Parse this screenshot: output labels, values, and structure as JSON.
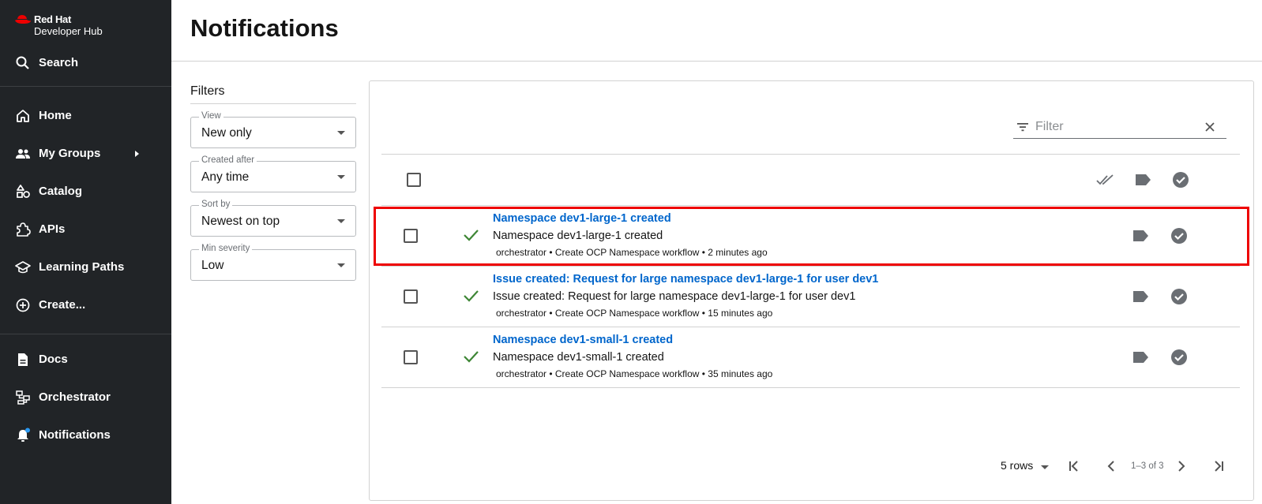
{
  "brand": {
    "line1": "Red Hat",
    "line2": "Developer Hub"
  },
  "nav": {
    "search": "Search",
    "home": "Home",
    "my_groups": "My Groups",
    "catalog": "Catalog",
    "apis": "APIs",
    "learning_paths": "Learning Paths",
    "create": "Create...",
    "docs": "Docs",
    "orchestrator": "Orchestrator",
    "notifications": "Notifications"
  },
  "page": {
    "title": "Notifications"
  },
  "filters": {
    "title": "Filters",
    "view": {
      "label": "View",
      "value": "New only"
    },
    "created_after": {
      "label": "Created after",
      "value": "Any time"
    },
    "sort_by": {
      "label": "Sort by",
      "value": "Newest on top"
    },
    "min_severity": {
      "label": "Min severity",
      "value": "Low"
    }
  },
  "search": {
    "placeholder": "Filter"
  },
  "rows": [
    {
      "title": "Namespace dev1-large-1 created",
      "description": "Namespace dev1-large-1 created",
      "meta": "orchestrator • Create OCP Namespace workflow • 2 minutes ago"
    },
    {
      "title": "Issue created: Request for large namespace dev1-large-1 for user dev1",
      "description": "Issue created: Request for large namespace dev1-large-1 for user dev1",
      "meta": "orchestrator • Create OCP Namespace workflow • 15 minutes ago"
    },
    {
      "title": "Namespace dev1-small-1 created",
      "description": "Namespace dev1-small-1 created",
      "meta": "orchestrator • Create OCP Namespace workflow • 35 minutes ago"
    }
  ],
  "pagination": {
    "rows_per_page": "5 rows",
    "range": "1–3 of 3"
  },
  "colors": {
    "sidebar_bg": "#212427",
    "link": "#0066cc",
    "success": "#3e8635",
    "highlight": "#ee0000",
    "notification_dot": "#2b9af3"
  }
}
